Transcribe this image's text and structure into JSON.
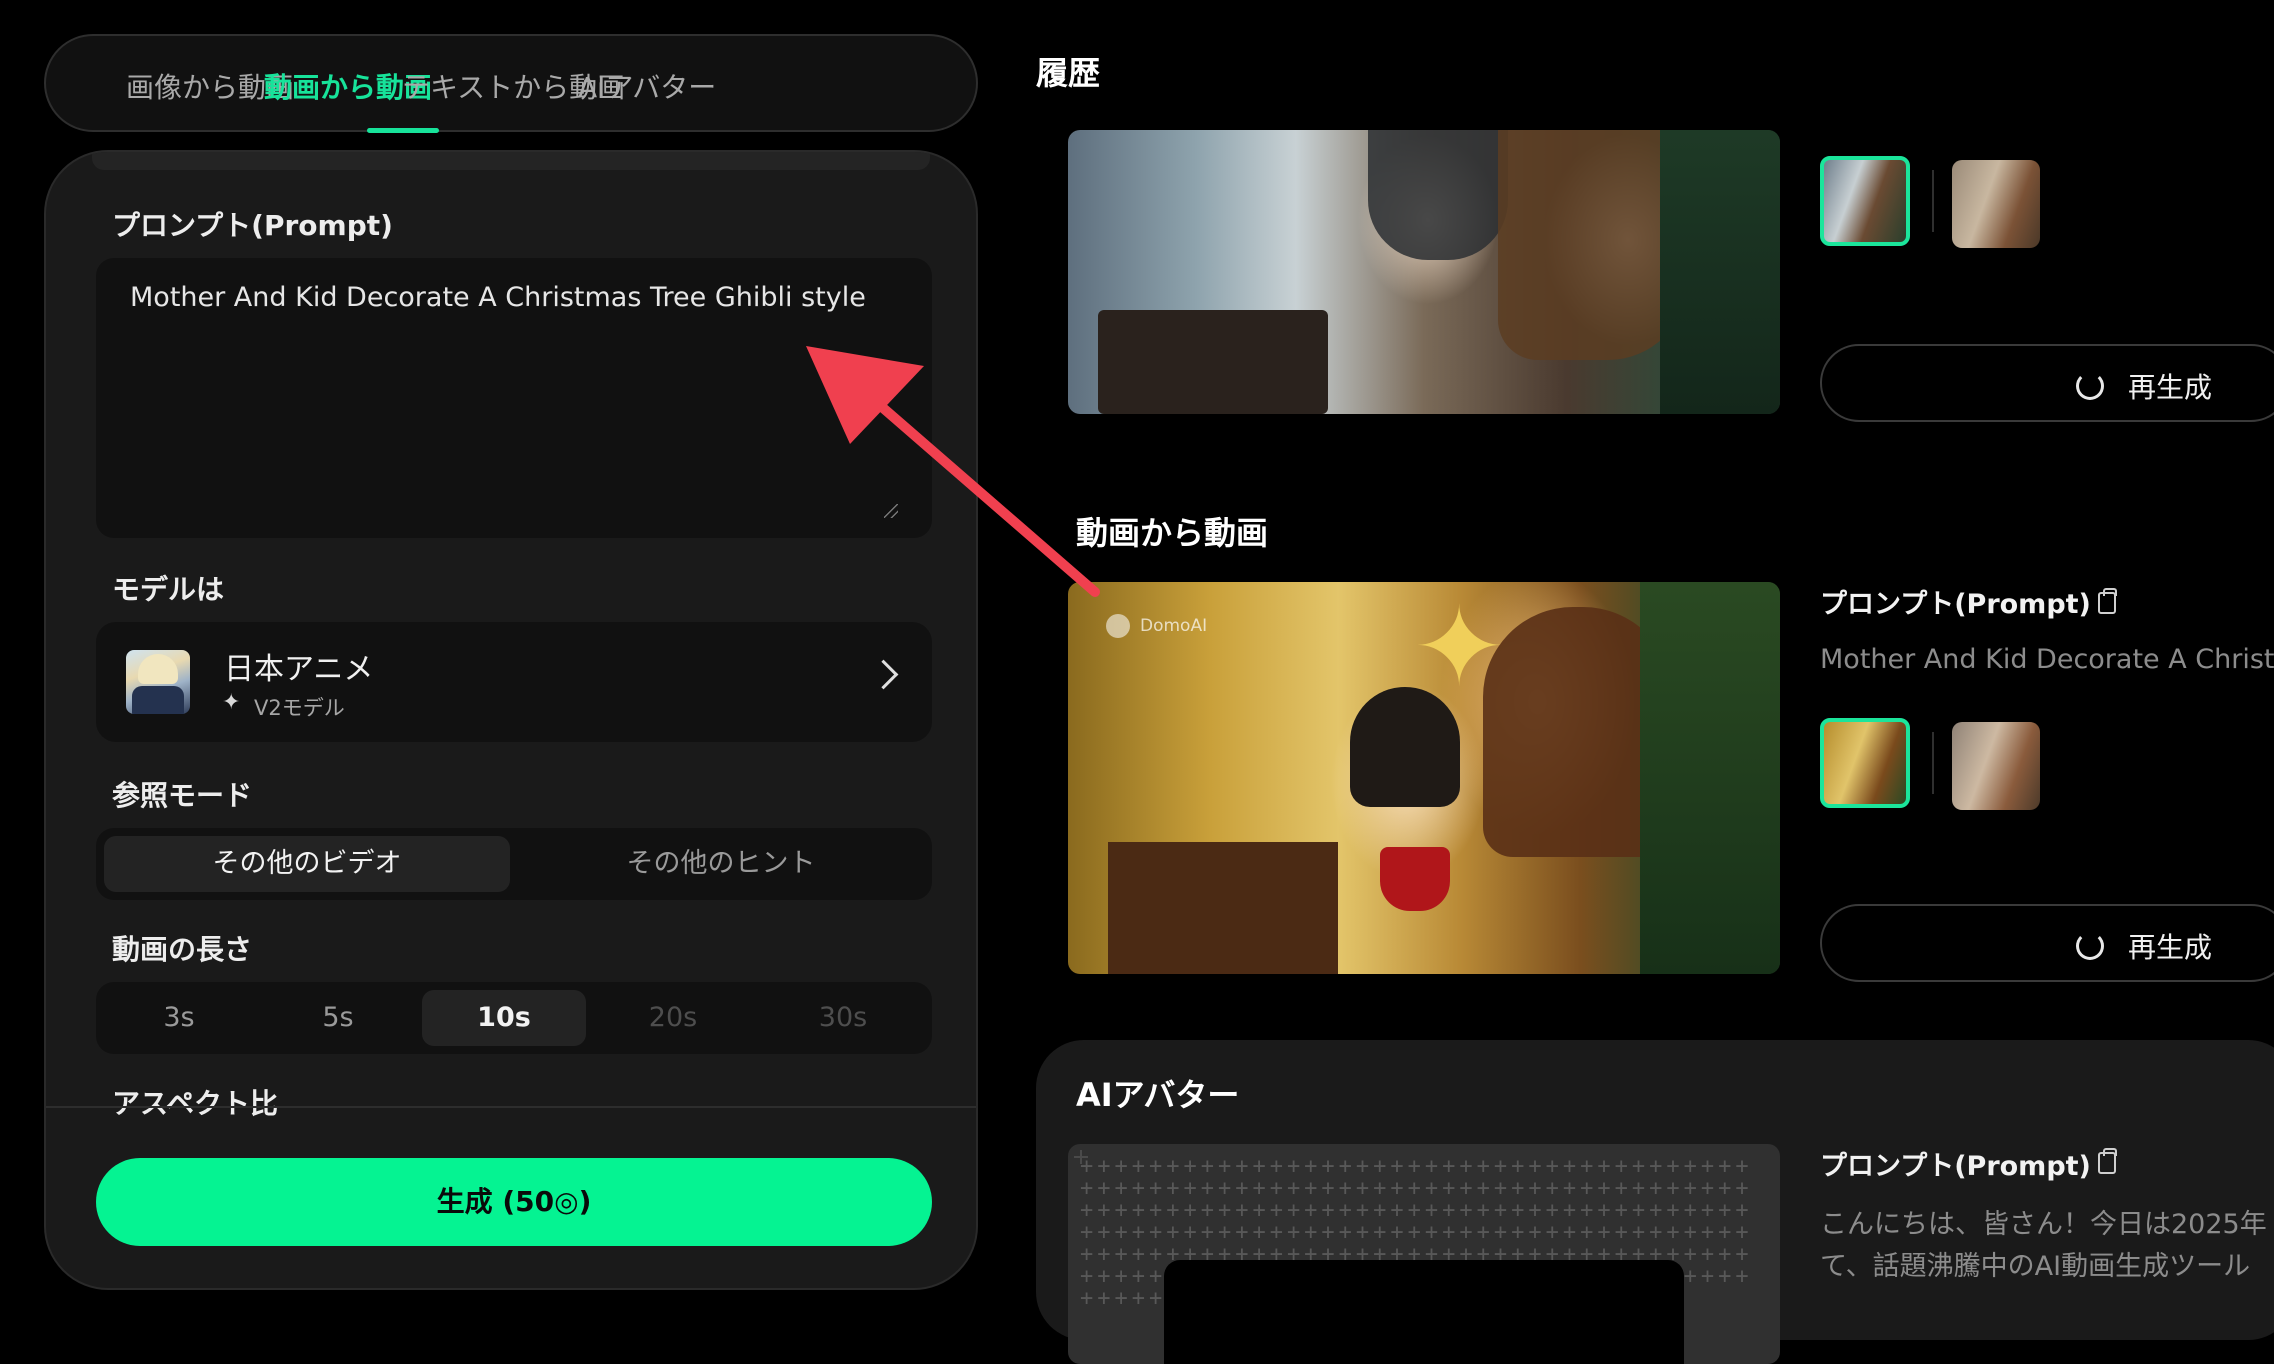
{
  "tabs": {
    "items": [
      "画像から動画",
      "動画から動画",
      "テキストから動画",
      "AIアバター"
    ],
    "active_index": 1
  },
  "panel": {
    "prompt_label": "プロンプト(Prompt)",
    "prompt_value": "Mother And Kid Decorate A Christmas Tree Ghibli style",
    "model_label": "モデルは",
    "model_name": "日本アニメ",
    "model_sub": "V2モデル",
    "ref_mode_label": "参照モード",
    "ref_mode_options": [
      "その他のビデオ",
      "その他のヒント"
    ],
    "ref_mode_selected": 0,
    "length_label": "動画の長さ",
    "length_options": [
      "3s",
      "5s",
      "10s",
      "20s",
      "30s"
    ],
    "length_selected": "10s",
    "aspect_label": "アスペクト比",
    "generate_label": "生成 (50◎)"
  },
  "history": {
    "title": "履歴",
    "entry1": {
      "regenerate_label": "再生成"
    },
    "entry2": {
      "title": "動画から動画",
      "prompt_label": "プロンプト(Prompt)",
      "prompt_text": "Mother And Kid Decorate A Christm",
      "watermark": "DomoAI",
      "regenerate_label": "再生成"
    },
    "entry3": {
      "title": "AIアバター",
      "prompt_label": "プロンプト(Prompt)",
      "text_line1": "こんにちは、皆さん！今日は2025年",
      "text_line2": "て、話題沸騰中のAI動画生成ツール"
    }
  },
  "colors": {
    "accent": "#05f392",
    "active_tab": "#17e39a",
    "annotation_arrow": "#f0404f"
  },
  "icons": [
    "chevron-right-icon",
    "sparkle-icon",
    "regenerate-icon",
    "copy-icon",
    "resize-grip-icon"
  ]
}
